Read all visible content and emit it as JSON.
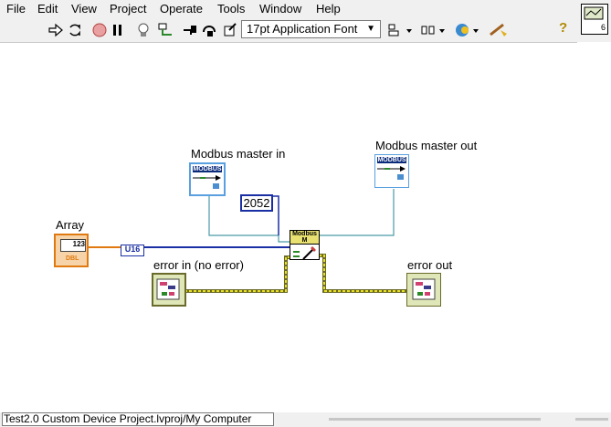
{
  "menu": [
    "File",
    "Edit",
    "View",
    "Project",
    "Operate",
    "Tools",
    "Window",
    "Help"
  ],
  "toolbar": {
    "font_select": "17pt Application Font",
    "icons": [
      "run-arrow-icon",
      "run-continuously-icon",
      "abort-icon",
      "pause-icon",
      "highlight-execution-icon",
      "retain-wire-values-icon",
      "step-into-icon",
      "step-over-icon",
      "step-out-icon",
      "align-objects-icon",
      "distribute-objects-icon",
      "reorder-icon",
      "clean-up-diagram-icon",
      "help-icon"
    ],
    "help_label": "?"
  },
  "connector_pane": {
    "number": "6"
  },
  "diagram": {
    "labels": {
      "master_in": "Modbus master in",
      "master_out": "Modbus master out",
      "array": "Array",
      "error_in": "error in (no error)",
      "error_out": "error out"
    },
    "constant": "2052",
    "coercion": "U16",
    "master_in_text": "MODBUS",
    "master_out_text": "MODBUS",
    "array_tag": "123",
    "array_type": "DBL",
    "subvi_label": "Modbus M"
  },
  "colors": {
    "wire_class": "#4a9aa8",
    "wire_u16": "#1a2fa3",
    "wire_dbl": "#e07a10",
    "wire_error": "#c8c020",
    "error_cluster": "#6a6a2a"
  },
  "statusbar": {
    "path": "Test2.0 Custom Device Project.lvproj/My Computer"
  }
}
